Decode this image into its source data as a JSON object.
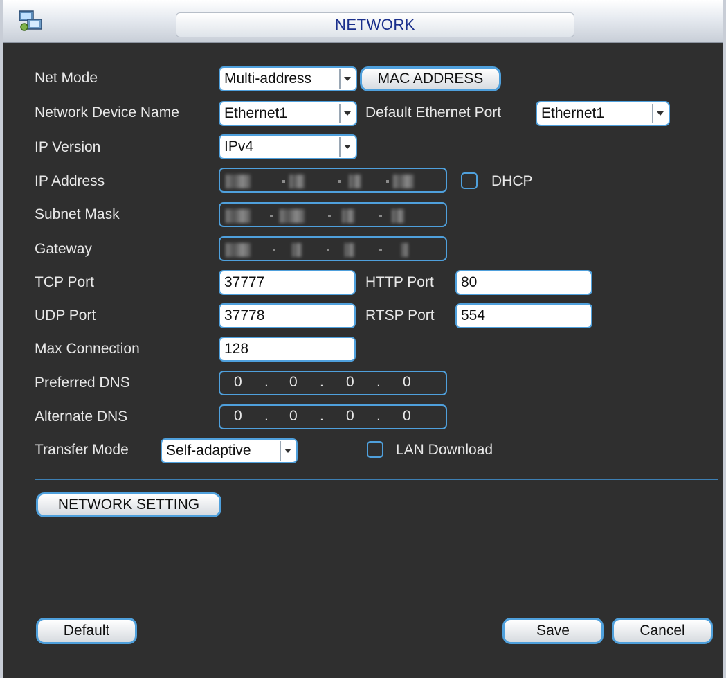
{
  "window": {
    "title": "NETWORK"
  },
  "fields": {
    "net_mode": {
      "label": "Net Mode",
      "value": "Multi-address"
    },
    "mac_address_button": "MAC ADDRESS",
    "network_device_name": {
      "label": "Network Device Name",
      "value": "Ethernet1"
    },
    "default_ethernet_port": {
      "label": "Default Ethernet Port",
      "value": "Ethernet1"
    },
    "ip_version": {
      "label": "IP Version",
      "value": "IPv4"
    },
    "ip_address": {
      "label": "IP Address"
    },
    "dhcp": {
      "label": "DHCP",
      "checked": false
    },
    "subnet_mask": {
      "label": "Subnet Mask"
    },
    "gateway": {
      "label": "Gateway"
    },
    "tcp_port": {
      "label": "TCP Port",
      "value": "37777"
    },
    "http_port": {
      "label": "HTTP Port",
      "value": "80"
    },
    "udp_port": {
      "label": "UDP Port",
      "value": "37778"
    },
    "rtsp_port": {
      "label": "RTSP Port",
      "value": "554"
    },
    "max_connection": {
      "label": "Max Connection",
      "value": "128"
    },
    "preferred_dns": {
      "label": "Preferred DNS",
      "octets": [
        "0",
        "0",
        "0",
        "0"
      ]
    },
    "alternate_dns": {
      "label": "Alternate DNS",
      "octets": [
        "0",
        "0",
        "0",
        "0"
      ]
    },
    "transfer_mode": {
      "label": "Transfer Mode",
      "value": "Self-adaptive"
    },
    "lan_download": {
      "label": "LAN Download",
      "checked": false
    }
  },
  "buttons": {
    "network_setting": "NETWORK SETTING",
    "default": "Default",
    "save": "Save",
    "cancel": "Cancel"
  },
  "dot": ".",
  "colors": {
    "accent": "#4fa0dc",
    "title_text": "#1a2f8c",
    "background": "#2f2f2f",
    "label_text": "#e8e8e8"
  },
  "icons": {
    "app": "network-settings-icon",
    "dropdown": "chevron-down-icon"
  }
}
